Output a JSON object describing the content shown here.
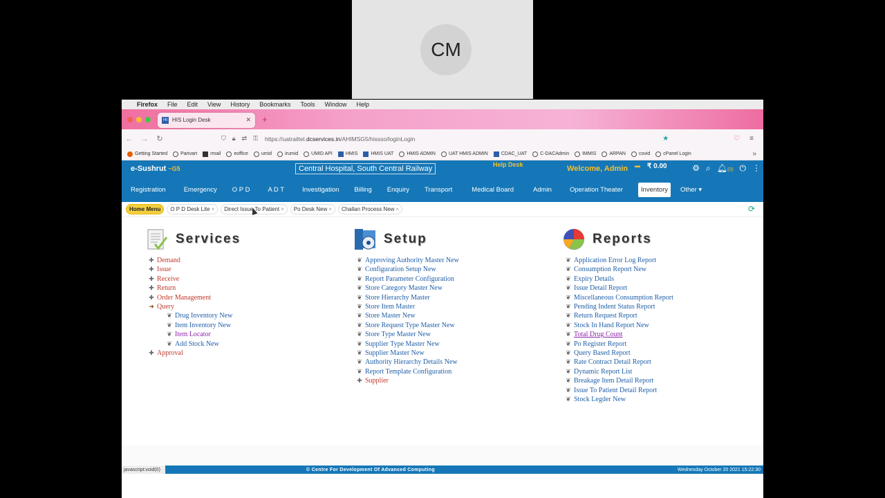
{
  "call": {
    "participant_initials": "CM"
  },
  "mac_menu": {
    "app": "Firefox",
    "items": [
      "File",
      "Edit",
      "View",
      "History",
      "Bookmarks",
      "Tools",
      "Window",
      "Help"
    ]
  },
  "browser": {
    "tab_title": "HIS Login Desk",
    "url_prefix": "https://uatrailtel.",
    "url_domain": "dcservices.in",
    "url_path": "/AHIMSG5/hissso/loginLogin",
    "bookmarks": [
      "Getting Started",
      "Parivart",
      "rmail",
      "eoffice",
      "umid",
      "irumid",
      "UMID API",
      "HMIS",
      "HMIS UAT",
      "HMIS ADMIN",
      "UAT HMIS ADMIN",
      "CDAC_UAT",
      "C-DACAdmin",
      "IMMIS",
      "ARPAN",
      "covid",
      "cPanel Login"
    ]
  },
  "app": {
    "brand": "e-Sushrut",
    "brand_suffix": "~G5",
    "hospital": "Central Hospital, South Central Railway",
    "help_desk": "Help Desk",
    "welcome": "Welcome, Admin",
    "balance": "₹ 0.00",
    "notif_count": "(0)",
    "nav": [
      "Registration",
      "Emergency",
      "O P D",
      "A D T",
      "Investigation",
      "Billing",
      "Enquiry",
      "Transport",
      "Medical Board",
      "Admin",
      "Operation Theater",
      "Inventory",
      "Other ▾"
    ],
    "nav_active": "Inventory",
    "work_tabs": [
      "Home Menu",
      "O P D Desk Lite",
      "Direct Issue To Patient",
      "Po Desk New",
      "Challan Process New"
    ]
  },
  "services": {
    "title": "Services",
    "items": [
      {
        "label": "Demand",
        "color": "red"
      },
      {
        "label": "Issue",
        "color": "red"
      },
      {
        "label": "Receive",
        "color": "red"
      },
      {
        "label": "Return",
        "color": "red"
      },
      {
        "label": "Order Management",
        "color": "red"
      },
      {
        "label": "Query",
        "color": "red",
        "expanded": true
      },
      {
        "label": "Drug Inventory New",
        "color": "blue",
        "sub": true
      },
      {
        "label": "Item Inventory New",
        "color": "blue",
        "sub": true
      },
      {
        "label": "Item Locator",
        "color": "purple-plain",
        "sub": true
      },
      {
        "label": "Add Stock New",
        "color": "blue",
        "sub": true
      },
      {
        "label": "Approval",
        "color": "red"
      }
    ]
  },
  "setup": {
    "title": "Setup",
    "items": [
      "Approving Authority Master New",
      "Configuration Setup New",
      "Report Parameter Configuration",
      "Store Category Master New",
      "Store Hierarchy Master",
      "Store Item Master",
      "Store Master New",
      "Store Request Type Master New",
      "Store Type Master New",
      "Supplier Type Master New",
      "Supplier Master New",
      "Authority Hierarchy Details New",
      "Report Template Configuration",
      "Supplier"
    ]
  },
  "reports": {
    "title": "Reports",
    "items": [
      "Application Error Log Report",
      "Consumption Report New",
      "Expiry Details",
      "Issue Detail Report",
      "Miscellaneous Consumption Report",
      "Pending Indent Status Report",
      "Return Request Report",
      "Stock In Hand Report New",
      "Total Drug Count",
      "Po Register Report",
      "Query Based Report",
      "Rate Contract Detail Report",
      "Dynamic Report List",
      "Breakage Item Detail Report",
      "Issue To Patient Detail Report",
      "Stock Legder New"
    ],
    "highlighted": "Total Drug Count"
  },
  "status": {
    "left": "javascript:void(0)",
    "center": "© Centre For Development Of Advanced Computing",
    "right": "Wednesday October 20 2021 15:22:30"
  },
  "colors": {
    "header_blue": "#1577b7",
    "accent_yellow": "#f6c02e"
  }
}
